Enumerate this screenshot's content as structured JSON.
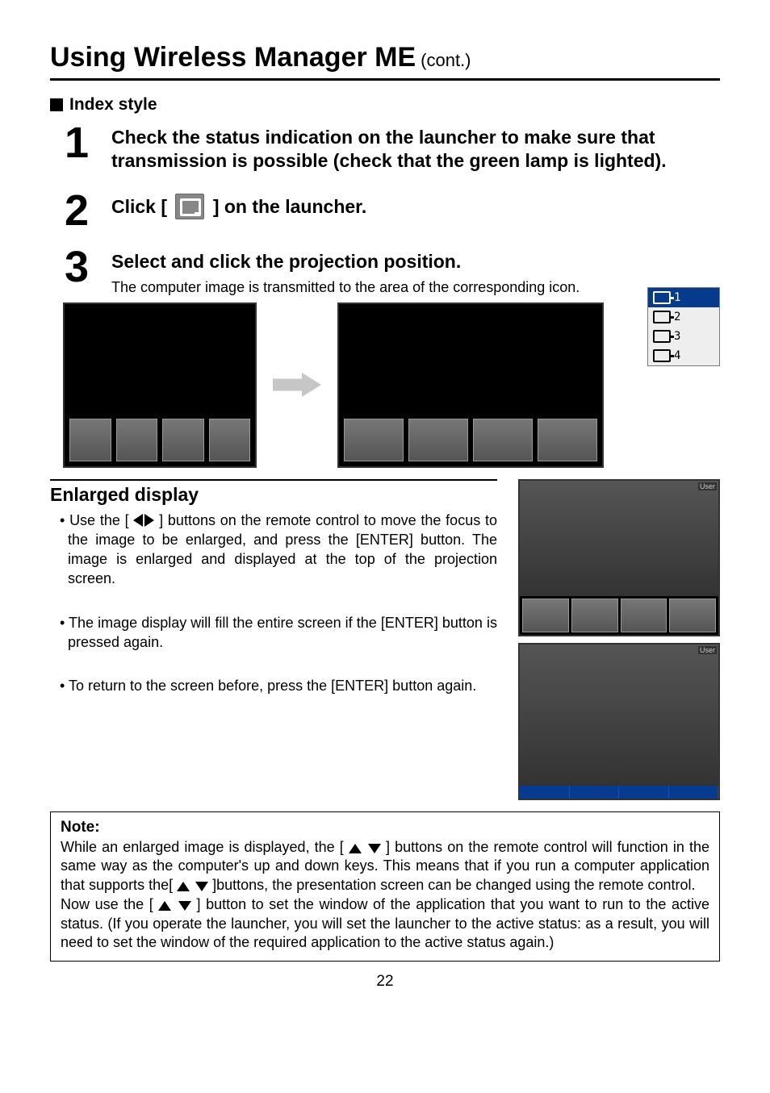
{
  "header": {
    "main": "Using Wireless Manager ME",
    "cont": "(cont.)"
  },
  "subheading": "Index style",
  "steps": {
    "s1": {
      "num": "1",
      "title": "Check the status indication on the launcher to make sure that transmission is possible (check that the green lamp is lighted)."
    },
    "s2": {
      "num": "2",
      "title_pre": "Click [",
      "title_post": "] on the launcher."
    },
    "s3": {
      "num": "3",
      "title": "Select and click the projection position.",
      "desc": "The computer image is transmitted to the area of the corresponding icon."
    }
  },
  "proj_menu": {
    "items": [
      "1",
      "2",
      "3",
      "4"
    ],
    "selected_index": 0
  },
  "enlarged": {
    "heading": "Enlarged display",
    "b1_pre": "Use the [",
    "b1_post": "] buttons on the remote control to move the focus to the image to be enlarged, and press the [ENTER] button. The image is enlarged and displayed at the top of the projection screen.",
    "b2": "The image display will fill the entire screen if the [ENTER] button is pressed again.",
    "b3": "To return to the screen before, press the [ENTER] button again."
  },
  "note": {
    "title": "Note:",
    "p1_pre": "While an enlarged image is displayed, the [",
    "p1_mid": "] buttons on the remote control will function in the same way as the computer's up and down keys. This means that if you run a computer application that supports the[",
    "p1_post": "]buttons, the presentation screen can be changed using the remote control.",
    "p2_pre": "Now use the [",
    "p2_post": "] button to set the window of the application that you want to run to the active status. (If you operate the launcher, you will set the launcher to the active status: as a result, you will need to set the window of the required application to the active status again.)"
  },
  "illus": {
    "tag_user": "User"
  },
  "footer": "22"
}
